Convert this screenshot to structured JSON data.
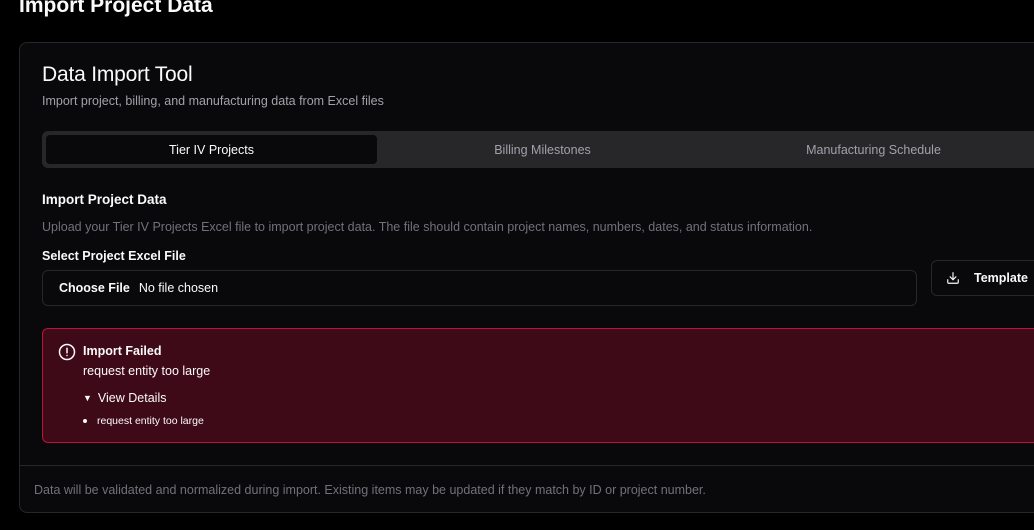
{
  "page": {
    "title": "Import Project Data"
  },
  "card": {
    "title": "Data Import Tool",
    "subtitle": "Import project, billing, and manufacturing data from Excel files"
  },
  "tabs": [
    {
      "label": "Tier IV Projects",
      "active": true
    },
    {
      "label": "Billing Milestones",
      "active": false
    },
    {
      "label": "Manufacturing Schedule",
      "active": false
    }
  ],
  "section": {
    "title": "Import Project Data",
    "description": "Upload your Tier IV Projects Excel file to import project data. The file should contain project names, numbers, dates, and status information."
  },
  "file_field": {
    "label": "Select Project Excel File",
    "button_label": "Choose File",
    "status": "No file chosen"
  },
  "template_button": {
    "label": "Template",
    "icon": "download-icon"
  },
  "alert": {
    "icon": "alert-circle-icon",
    "title": "Import Failed",
    "message": "request entity too large",
    "details_label": "View Details",
    "details": [
      "request entity too large"
    ]
  },
  "footer": {
    "text": "Data will be validated and normalized during import. Existing items may be updated if they match by ID or project number."
  },
  "colors": {
    "background": "#000000",
    "card": "#09090b",
    "border": "#27272a",
    "alert_bg": "#3f0a17",
    "alert_border": "#be123c",
    "muted_text": "#a1a1aa"
  }
}
